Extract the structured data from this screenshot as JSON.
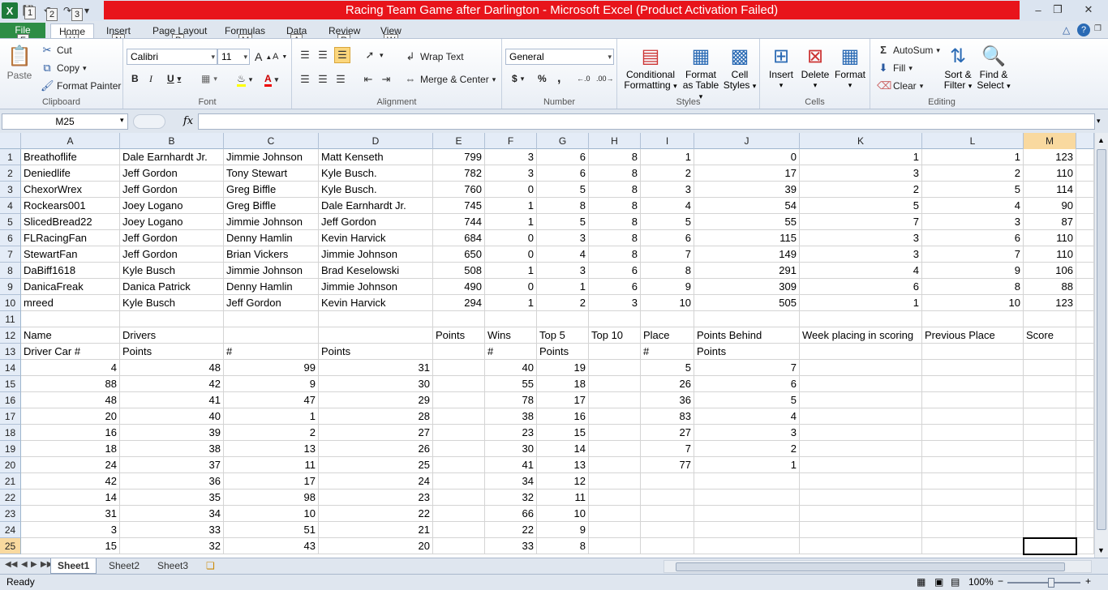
{
  "window": {
    "title": "Racing Team Game after Darlington  -  Microsoft Excel (Product Activation Failed)",
    "qat_keytips": [
      "1",
      "2",
      "3"
    ],
    "app_icon": "X"
  },
  "tabs": [
    {
      "label": "File",
      "keytip": "F"
    },
    {
      "label": "Home",
      "keytip": "H"
    },
    {
      "label": "Insert",
      "keytip": "N"
    },
    {
      "label": "Page Layout",
      "keytip": "P"
    },
    {
      "label": "Formulas",
      "keytip": "M"
    },
    {
      "label": "Data",
      "keytip": "A"
    },
    {
      "label": "Review",
      "keytip": "R"
    },
    {
      "label": "View",
      "keytip": "W"
    }
  ],
  "ribbon": {
    "clipboard": {
      "label": "Clipboard",
      "paste": "Paste",
      "cut": "Cut",
      "copy": "Copy",
      "format_painter": "Format Painter"
    },
    "font": {
      "label": "Font",
      "name": "Calibri",
      "size": "11"
    },
    "alignment": {
      "label": "Alignment",
      "wrap_text": "Wrap Text",
      "merge_center": "Merge & Center"
    },
    "number": {
      "label": "Number",
      "format": "General",
      "currency": "$",
      "percent": "%",
      "comma": ","
    },
    "styles": {
      "label": "Styles",
      "conditional_1": "Conditional",
      "conditional_2": "Formatting",
      "table_1": "Format",
      "table_2": "as Table",
      "cell_1": "Cell",
      "cell_2": "Styles"
    },
    "cells": {
      "label": "Cells",
      "insert": "Insert",
      "delete": "Delete",
      "format": "Format"
    },
    "editing": {
      "label": "Editing",
      "autosum": "AutoSum",
      "fill": "Fill",
      "clear": "Clear",
      "sort_1": "Sort &",
      "sort_2": "Filter",
      "find_1": "Find &",
      "find_2": "Select"
    }
  },
  "formula_bar": {
    "name_box": "M25",
    "fx": "fx",
    "value": ""
  },
  "columns": [
    "A",
    "B",
    "C",
    "D",
    "E",
    "F",
    "G",
    "H",
    "I",
    "J",
    "K",
    "L",
    "M"
  ],
  "rows": [
    "1",
    "2",
    "3",
    "4",
    "5",
    "6",
    "7",
    "8",
    "9",
    "10",
    "11",
    "12",
    "13",
    "14",
    "15",
    "16",
    "17",
    "18",
    "19",
    "20",
    "21",
    "22",
    "23",
    "24",
    "25"
  ],
  "cells": [
    [
      "Breathoflife",
      "Dale Earnhardt Jr.",
      "Jimmie Johnson",
      "Matt Kenseth",
      "799",
      "3",
      "6",
      "8",
      "1",
      "0",
      "1",
      "1",
      "123"
    ],
    [
      "Deniedlife",
      "Jeff Gordon",
      "Tony Stewart",
      "Kyle Busch.",
      "782",
      "3",
      "6",
      "8",
      "2",
      "17",
      "3",
      "2",
      "110"
    ],
    [
      "ChexorWrex",
      "Jeff Gordon",
      "Greg Biffle",
      "Kyle Busch.",
      "760",
      "0",
      "5",
      "8",
      "3",
      "39",
      "2",
      "5",
      "114"
    ],
    [
      "Rockears001",
      "Joey Logano",
      "Greg Biffle",
      "Dale Earnhardt Jr.",
      "745",
      "1",
      "8",
      "8",
      "4",
      "54",
      "5",
      "4",
      "90"
    ],
    [
      "SlicedBread22",
      "Joey Logano",
      "Jimmie Johnson",
      "Jeff Gordon",
      "744",
      "1",
      "5",
      "8",
      "5",
      "55",
      "7",
      "3",
      "87"
    ],
    [
      "FLRacingFan",
      "Jeff Gordon",
      "Denny Hamlin",
      "Kevin Harvick",
      "684",
      "0",
      "3",
      "8",
      "6",
      "115",
      "3",
      "6",
      "110"
    ],
    [
      "StewartFan",
      "Jeff Gordon",
      "Brian Vickers",
      "Jimmie Johnson",
      "650",
      "0",
      "4",
      "8",
      "7",
      "149",
      "3",
      "7",
      "110"
    ],
    [
      "DaBiff1618",
      "Kyle Busch",
      "Jimmie Johnson",
      "Brad Keselowski",
      "508",
      "1",
      "3",
      "6",
      "8",
      "291",
      "4",
      "9",
      "106"
    ],
    [
      "DanicaFreak",
      "Danica Patrick",
      "Denny Hamlin",
      "Jimmie Johnson",
      "490",
      "0",
      "1",
      "6",
      "9",
      "309",
      "6",
      "8",
      "88"
    ],
    [
      "mreed",
      "Kyle Busch",
      "Jeff Gordon",
      "Kevin Harvick",
      "294",
      "1",
      "2",
      "3",
      "10",
      "505",
      "1",
      "10",
      "123"
    ],
    [
      "",
      "",
      "",
      "",
      "",
      "",
      "",
      "",
      "",
      "",
      "",
      "",
      ""
    ],
    [
      "Name",
      "Drivers",
      "",
      "",
      "Points",
      "Wins",
      "Top 5",
      "Top 10",
      "Place",
      "Points Behind",
      "Week placing in scoring",
      "Previous Place",
      "Score"
    ],
    [
      "Driver Car #",
      "Points",
      "#",
      "Points",
      "",
      "#",
      "Points",
      "",
      "#",
      "Points",
      "",
      "",
      ""
    ],
    [
      "4",
      "48",
      "99",
      "31",
      "",
      "40",
      "19",
      "",
      "5",
      "7",
      "",
      "",
      ""
    ],
    [
      "88",
      "42",
      "9",
      "30",
      "",
      "55",
      "18",
      "",
      "26",
      "6",
      "",
      "",
      ""
    ],
    [
      "48",
      "41",
      "47",
      "29",
      "",
      "78",
      "17",
      "",
      "36",
      "5",
      "",
      "",
      ""
    ],
    [
      "20",
      "40",
      "1",
      "28",
      "",
      "38",
      "16",
      "",
      "83",
      "4",
      "",
      "",
      ""
    ],
    [
      "16",
      "39",
      "2",
      "27",
      "",
      "23",
      "15",
      "",
      "27",
      "3",
      "",
      "",
      ""
    ],
    [
      "18",
      "38",
      "13",
      "26",
      "",
      "30",
      "14",
      "",
      "7",
      "2",
      "",
      "",
      ""
    ],
    [
      "24",
      "37",
      "11",
      "25",
      "",
      "41",
      "13",
      "",
      "77",
      "1",
      "",
      "",
      ""
    ],
    [
      "42",
      "36",
      "17",
      "24",
      "",
      "34",
      "12",
      "",
      "",
      "",
      "",
      "",
      ""
    ],
    [
      "14",
      "35",
      "98",
      "23",
      "",
      "32",
      "11",
      "",
      "",
      "",
      "",
      "",
      ""
    ],
    [
      "31",
      "34",
      "10",
      "22",
      "",
      "66",
      "10",
      "",
      "",
      "",
      "",
      "",
      ""
    ],
    [
      "3",
      "33",
      "51",
      "21",
      "",
      "22",
      "9",
      "",
      "",
      "",
      "",
      "",
      ""
    ],
    [
      "15",
      "32",
      "43",
      "20",
      "",
      "33",
      "8",
      "",
      "",
      "",
      "",
      "",
      ""
    ]
  ],
  "sheets": [
    "Sheet1",
    "Sheet2",
    "Sheet3"
  ],
  "status": {
    "text": "Ready",
    "zoom": "100%"
  }
}
